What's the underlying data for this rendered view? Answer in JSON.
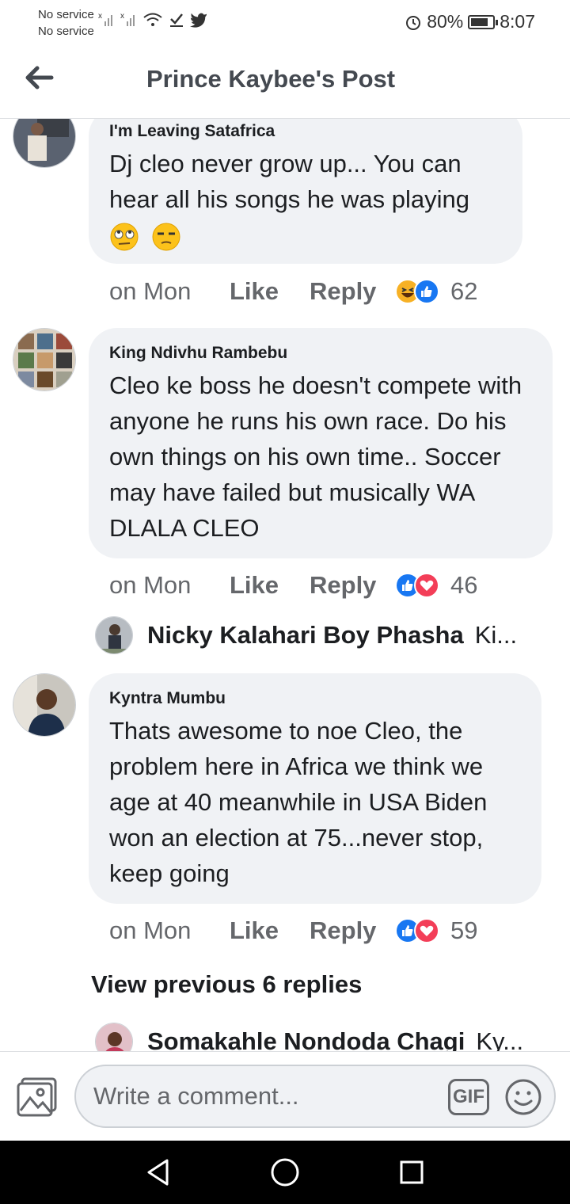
{
  "status_bar": {
    "carrier_1": "No service",
    "carrier_2": "No service",
    "battery": "80%",
    "battery_level": 0.8,
    "time": "8:07"
  },
  "header": {
    "title": "Prince Kaybee's Post",
    "back_icon": "arrow-left-icon"
  },
  "comments": [
    {
      "author": "I'm Leaving Satafrica",
      "text": "Dj cleo never grow up... You can hear all his songs he was playing",
      "emoji": [
        "eye-roll-emoji",
        "unamused-emoji"
      ],
      "time": "on Mon",
      "like_label": "Like",
      "reply_label": "Reply",
      "reactions": [
        "haha",
        "like"
      ],
      "reaction_count": "62"
    },
    {
      "author": "King Ndivhu Rambebu",
      "text": "Cleo ke boss he doesn't compete with anyone he runs his own race. Do his own things on his own time.. Soccer may have failed but musically WA DLALA CLEO",
      "time": "on Mon",
      "like_label": "Like",
      "reply_label": "Reply",
      "reactions": [
        "like",
        "love"
      ],
      "reaction_count": "46",
      "reply_preview": {
        "name": "Nicky Kalahari Boy Phasha",
        "snippet": "Ki..."
      }
    },
    {
      "author": "Kyntra Mumbu",
      "text": "Thats awesome to noe Cleo, the problem here in Africa we think we age at 40 meanwhile in USA Biden won an election at 75...never stop, keep going",
      "time": "on Mon",
      "like_label": "Like",
      "reply_label": "Reply",
      "reactions": [
        "like",
        "love"
      ],
      "reaction_count": "59",
      "view_previous": "View previous 6 replies",
      "reply_preview": {
        "name": "Somakahle Nondoda Chagi",
        "snippet": "Ky..."
      }
    }
  ],
  "composer": {
    "placeholder": "Write a comment...",
    "gif_label": "GIF",
    "photo_icon": "photo-icon",
    "emoji_icon": "smiley-icon"
  },
  "nav": {
    "back_icon": "triangle-back-icon",
    "home_icon": "circle-home-icon",
    "recent_icon": "square-recent-icon"
  },
  "colors": {
    "bubble_bg": "#f0f2f5",
    "like_blue": "#1877f2",
    "love_red": "#f33e58",
    "haha_yellow": "#f7b125",
    "meta_gray": "#65676b"
  }
}
